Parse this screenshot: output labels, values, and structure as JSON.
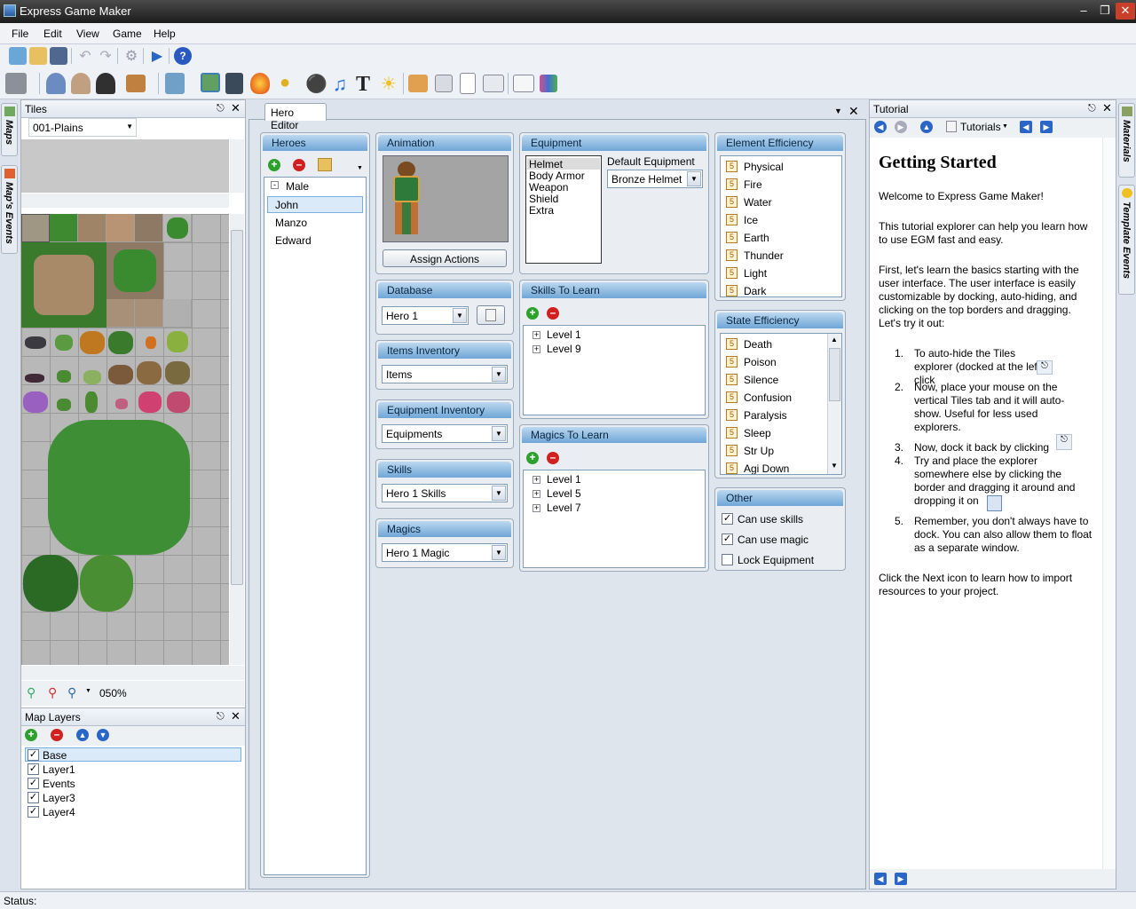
{
  "window": {
    "title": "Express Game Maker"
  },
  "menu": [
    "File",
    "Edit",
    "View",
    "Game",
    "Help"
  ],
  "status": {
    "label": "Status:"
  },
  "left_tabs": [
    "Maps",
    "Map's Events"
  ],
  "right_tabs": [
    "Materials",
    "Template Events"
  ],
  "tiles": {
    "title": "Tiles",
    "tileset": "001-Plains",
    "zoom": "050%"
  },
  "map_layers": {
    "title": "Map Layers",
    "items": [
      {
        "label": "Base",
        "checked": true,
        "selected": true
      },
      {
        "label": "Layer1",
        "checked": true
      },
      {
        "label": "Events",
        "checked": true
      },
      {
        "label": "Layer3",
        "checked": true
      },
      {
        "label": "Layer4",
        "checked": true
      }
    ]
  },
  "editor": {
    "tab": "Hero Editor"
  },
  "heroes": {
    "title": "Heroes",
    "group": "Male",
    "items": [
      "John",
      "Manzo",
      "Edward"
    ]
  },
  "animation": {
    "title": "Animation",
    "button": "Assign Actions"
  },
  "database": {
    "title": "Database",
    "value": "Hero 1"
  },
  "items_inventory": {
    "title": "Items Inventory",
    "value": "Items"
  },
  "equipment_inventory": {
    "title": "Equipment Inventory",
    "value": "Equipments"
  },
  "skills": {
    "title": "Skills",
    "value": "Hero 1 Skills"
  },
  "magics": {
    "title": "Magics",
    "value": "Hero 1 Magic"
  },
  "equipment": {
    "title": "Equipment",
    "slots": [
      "Helmet",
      "Body Armor",
      "Weapon",
      "Shield",
      "Extra"
    ],
    "default_label": "Default Equipment",
    "default_value": "Bronze Helmet"
  },
  "skills_to_learn": {
    "title": "Skills To Learn",
    "items": [
      "Level 1",
      "Level 9"
    ]
  },
  "magics_to_learn": {
    "title": "Magics To Learn",
    "items": [
      "Level 1",
      "Level 5",
      "Level 7"
    ]
  },
  "element_efficiency": {
    "title": "Element Efficiency",
    "items": [
      "Physical",
      "Fire",
      "Water",
      "Ice",
      "Earth",
      "Thunder",
      "Light",
      "Dark"
    ],
    "value": "5"
  },
  "state_efficiency": {
    "title": "State Efficiency",
    "items": [
      "Death",
      "Poison",
      "Silence",
      "Confusion",
      "Paralysis",
      "Sleep",
      "Str Up",
      "Agi Down"
    ],
    "value": "5"
  },
  "other": {
    "title": "Other",
    "items": [
      {
        "label": "Can use skills",
        "checked": true
      },
      {
        "label": "Can use magic",
        "checked": true
      },
      {
        "label": "Lock Equipment",
        "checked": false
      }
    ]
  },
  "tutorial": {
    "panel_title": "Tutorial",
    "nav_label": "Tutorials",
    "heading": "Getting Started",
    "welcome": "Welcome to Express Game Maker!",
    "intro": "This tutorial explorer can help you learn how to use EGM fast and easy.",
    "p_first": "First, let's learn the basics starting with the user interface. The user interface is easily customizable by docking, auto-hiding, and clicking on the top borders and dragging. Let's try it out:",
    "steps": [
      {
        "n": "1.",
        "text": "To auto-hide the Tiles explorer (docked at the left), click"
      },
      {
        "n": "2.",
        "text": "Now, place your mouse on the vertical Tiles tab and it will auto-show. Useful for less used explorers."
      },
      {
        "n": "3.",
        "text": "Now, dock it back by clicking"
      },
      {
        "n": "4.",
        "text": "Try and place the explorer somewhere else by clicking the border and dragging it around and dropping it on"
      },
      {
        "n": "5.",
        "text": "Remember, you don't always have to dock. You can also allow them to float as a separate window."
      }
    ],
    "outro": "Click the Next icon to learn how to import resources to your project."
  }
}
